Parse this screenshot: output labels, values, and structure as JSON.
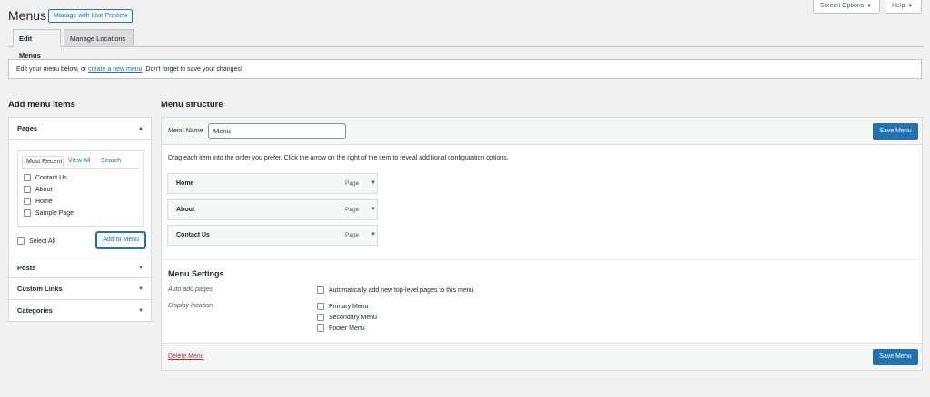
{
  "header": {
    "title": "Menus",
    "live_preview_label": "Manage with Live Preview",
    "screen_options_label": "Screen Options",
    "help_label": "Help"
  },
  "tabs": [
    {
      "label": "Edit Menus",
      "active": true
    },
    {
      "label": "Manage Locations",
      "active": false
    }
  ],
  "notice": {
    "before": "Edit your menu below, or ",
    "link": "create a new menu",
    "after": ". Don't forget to save your changes!"
  },
  "left": {
    "heading": "Add menu items",
    "pages": {
      "title": "Pages",
      "subtabs": [
        "Most Recent",
        "View All",
        "Search"
      ],
      "items": [
        "Contact Us",
        "About",
        "Home",
        "Sample Page"
      ],
      "select_all": "Select All",
      "add_button": "Add to Menu"
    },
    "sections": [
      "Posts",
      "Custom Links",
      "Categories"
    ]
  },
  "right": {
    "heading": "Menu structure",
    "menu_name_label": "Menu Name",
    "menu_name_value": "Menu",
    "save_label": "Save Menu",
    "instructions": "Drag each item into the order you prefer. Click the arrow on the right of the item to reveal additional configuration options.",
    "items": [
      {
        "title": "Home",
        "type": "Page"
      },
      {
        "title": "About",
        "type": "Page"
      },
      {
        "title": "Contact Us",
        "type": "Page"
      }
    ],
    "settings": {
      "title": "Menu Settings",
      "auto_add_label": "Auto add pages",
      "auto_add_option": "Automatically add new top-level pages to this menu",
      "display_location_label": "Display location",
      "locations": [
        "Primary Menu",
        "Secondary Menu",
        "Footer Menu"
      ]
    },
    "delete_label": "Delete Menu"
  },
  "colors": {
    "accent": "#2271b1",
    "delete": "#b32d2e",
    "background": "#f1f1f1"
  }
}
